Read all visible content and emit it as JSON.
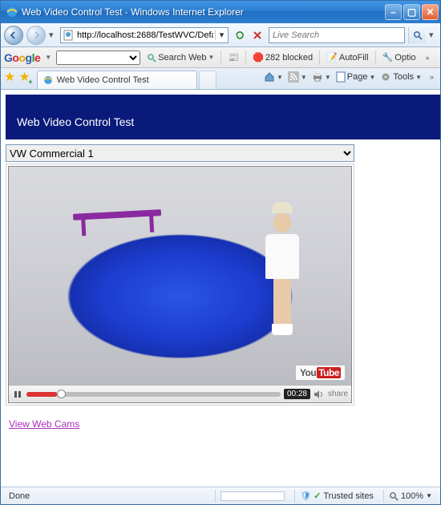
{
  "window": {
    "title": "Web Video Control Test - Windows Internet Explorer"
  },
  "navbar": {
    "url": "http://localhost:2688/TestWVC/Defa",
    "search_placeholder": "Live Search"
  },
  "google_toolbar": {
    "search_label": "Search Web",
    "blocked_label": "282 blocked",
    "autofill_label": "AutoFill",
    "options_label": "Optio"
  },
  "tabs": {
    "active_label": "Web Video Control Test"
  },
  "command_bar": {
    "page_label": "Page",
    "tools_label": "Tools"
  },
  "page": {
    "header_title": "Web Video Control Test",
    "video_select_value": "VW Commercial 1",
    "youtube_brand_a": "You",
    "youtube_brand_b": "Tube",
    "share_label": "share",
    "time_display": "00:28",
    "link_text": "View Web Cams"
  },
  "statusbar": {
    "status_text": "Done",
    "zone_text": "Trusted sites",
    "zoom_text": "100%"
  }
}
